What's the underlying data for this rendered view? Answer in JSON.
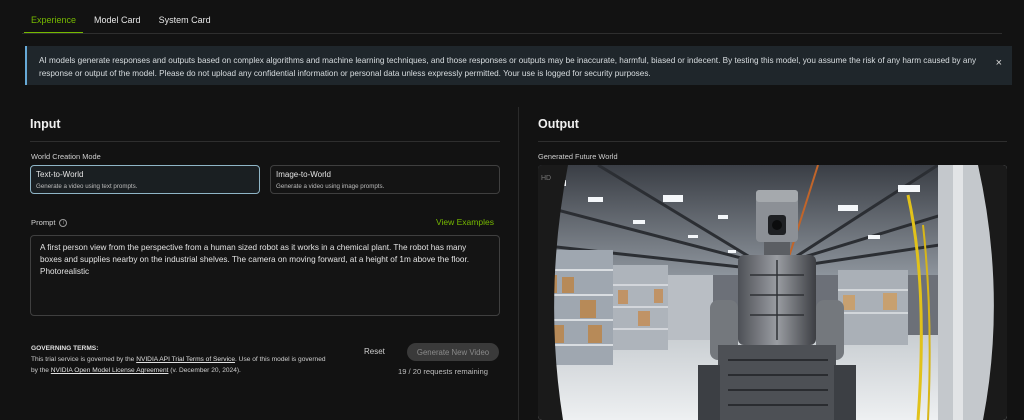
{
  "tabs": [
    {
      "label": "Experience",
      "active": true
    },
    {
      "label": "Model Card",
      "active": false
    },
    {
      "label": "System Card",
      "active": false
    }
  ],
  "banner": {
    "text": "AI models generate responses and outputs based on complex algorithms and machine learning techniques, and those responses or outputs may be inaccurate, harmful, biased or indecent. By testing this model, you assume the risk of any harm caused by any response or output of the model. Please do not upload any confidential information or personal data unless expressly permitted. Your use is logged for security purposes.",
    "close_glyph": "×"
  },
  "input": {
    "title": "Input",
    "mode_label": "World Creation Mode",
    "modes": [
      {
        "title": "Text-to-World",
        "description": "Generate a video using text prompts.",
        "selected": true
      },
      {
        "title": "Image-to-World",
        "description": "Generate a video using image prompts.",
        "selected": false
      }
    ],
    "prompt_label": "Prompt",
    "view_examples": "View Examples",
    "prompt_value": "A first person view from the perspective from a human sized robot as it works in a chemical plant. The robot has many boxes and supplies nearby on the industrial shelves. The camera on moving forward, at a height of 1m above the floor. Photorealistic"
  },
  "governing": {
    "title": "GOVERNING TERMS:",
    "text_1": "This trial service is governed by the ",
    "link_1": "NVIDIA API Trial Terms of Service",
    "text_2": ". Use of this model is governed by the ",
    "link_2": "NVIDIA Open Model License Agreement",
    "text_3": " (v. December 20, 2024)."
  },
  "actions": {
    "reset_label": "Reset",
    "generate_label": "Generate New Video",
    "requests_remaining": "19 / 20 requests remaining"
  },
  "output": {
    "title": "Output",
    "video_label": "Generated Future World",
    "badge": "HD"
  },
  "colors": {
    "accent": "#76b900",
    "banner_border": "#66a9d6"
  }
}
